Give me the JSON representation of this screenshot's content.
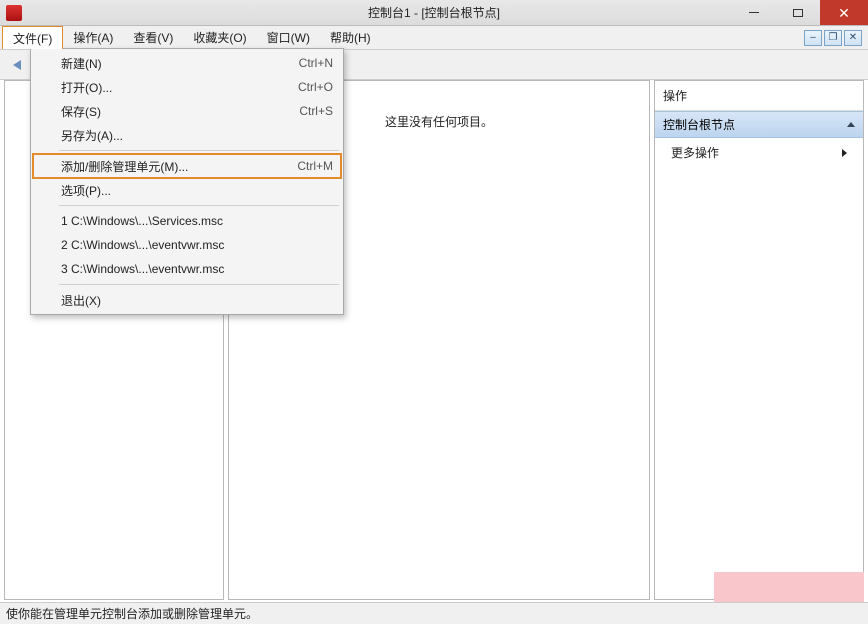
{
  "window": {
    "title": "控制台1 - [控制台根节点]"
  },
  "menubar": {
    "items": [
      {
        "label": "文件(F)"
      },
      {
        "label": "操作(A)"
      },
      {
        "label": "查看(V)"
      },
      {
        "label": "收藏夹(O)"
      },
      {
        "label": "窗口(W)"
      },
      {
        "label": "帮助(H)"
      }
    ]
  },
  "file_menu": {
    "new": {
      "label": "新建(N)",
      "shortcut": "Ctrl+N"
    },
    "open": {
      "label": "打开(O)...",
      "shortcut": "Ctrl+O"
    },
    "save": {
      "label": "保存(S)",
      "shortcut": "Ctrl+S"
    },
    "saveas": {
      "label": "另存为(A)..."
    },
    "snapin": {
      "label": "添加/删除管理单元(M)...",
      "shortcut": "Ctrl+M"
    },
    "options": {
      "label": "选项(P)..."
    },
    "recent": [
      {
        "label": "1 C:\\Windows\\...\\Services.msc"
      },
      {
        "label": "2 C:\\Windows\\...\\eventvwr.msc"
      },
      {
        "label": "3 C:\\Windows\\...\\eventvwr.msc"
      }
    ],
    "exit": {
      "label": "退出(X)"
    }
  },
  "content": {
    "empty_text": "这里没有任何项目。"
  },
  "actions": {
    "header": "操作",
    "section": "控制台根节点",
    "more": "更多操作"
  },
  "statusbar": {
    "text": "使你能在管理单元控制台添加或删除管理单元。"
  }
}
